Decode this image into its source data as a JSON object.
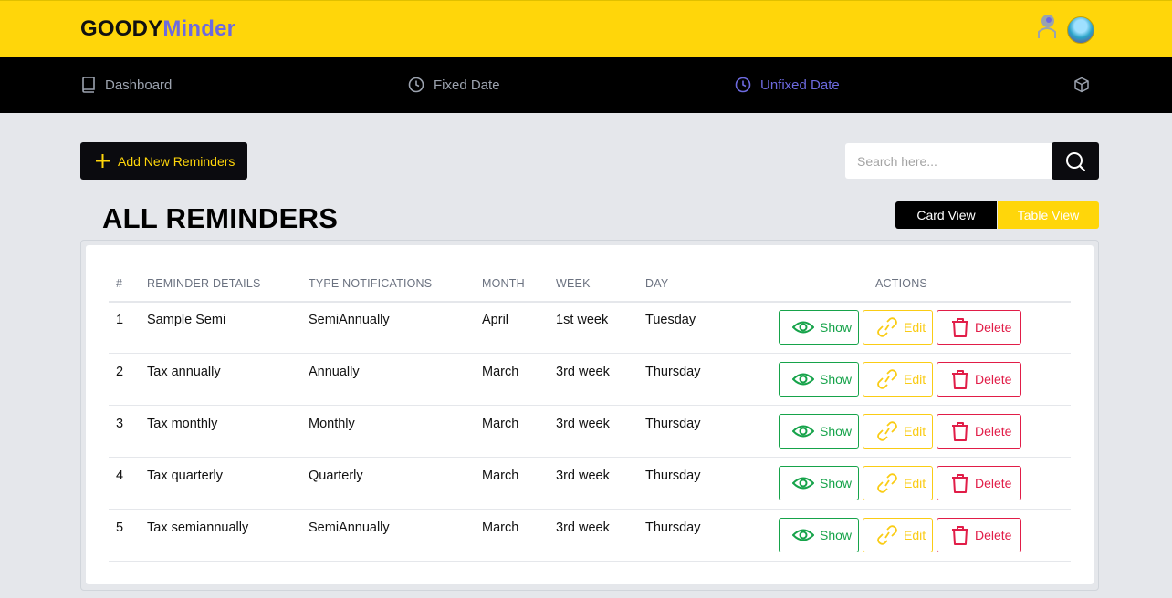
{
  "header": {
    "logo_part1": "GOODY",
    "logo_part2": "Minder"
  },
  "nav": [
    {
      "label": "Dashboard",
      "icon": "book-icon"
    },
    {
      "label": "Fixed Date",
      "icon": "clock-icon"
    },
    {
      "label": "Unfixed Date",
      "icon": "clock-icon",
      "active": true
    },
    {
      "label": "",
      "icon": "cube-icon"
    }
  ],
  "toolbar": {
    "add_label": "Add New Reminders",
    "search_placeholder": "Search here..."
  },
  "page": {
    "title": "ALL REMINDERS",
    "card_view": "Card View",
    "table_view": "Table View"
  },
  "table": {
    "headers": [
      "#",
      "REMINDER DETAILS",
      "TYPE NOTIFICATIONS",
      "MONTH",
      "WEEK",
      "DAY",
      "ACTIONS"
    ],
    "rows": [
      [
        "1",
        "Sample Semi",
        "SemiAnnually",
        "April",
        "1st week",
        "Tuesday"
      ],
      [
        "2",
        "Tax annually",
        "Annually",
        "March",
        "3rd week",
        "Thursday"
      ],
      [
        "3",
        "Tax monthly",
        "Monthly",
        "March",
        "3rd week",
        "Thursday"
      ],
      [
        "4",
        "Tax quarterly",
        "Quarterly",
        "March",
        "3rd week",
        "Thursday"
      ],
      [
        "5",
        "Tax semiannually",
        "SemiAnnually",
        "March",
        "3rd week",
        "Thursday"
      ]
    ],
    "actions": {
      "show": "Show",
      "edit": "Edit",
      "delete": "Delete"
    }
  },
  "colors": {
    "brand_yellow": "#ffd60a",
    "brand_purple": "#6d6adf",
    "nav_bg": "#000000",
    "show": "#16a34a",
    "edit": "#facc15",
    "delete": "#e11d48"
  }
}
